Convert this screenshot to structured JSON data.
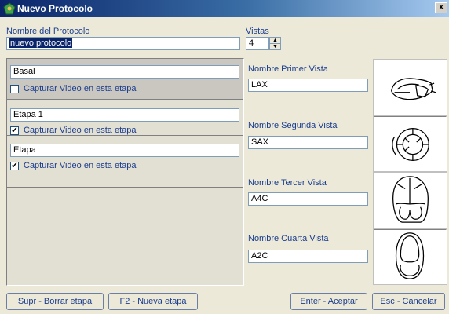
{
  "window": {
    "title": "Nuevo Protocolo",
    "close_label": "x"
  },
  "protocol": {
    "name_label": "Nombre del Protocolo",
    "name_value": "nuevo protocolo"
  },
  "views_count": {
    "label": "Vistas",
    "value": "4"
  },
  "stages": [
    {
      "name": "Basal",
      "capture_label": "Capturar Video en esta etapa",
      "checked": false
    },
    {
      "name": "Etapa 1",
      "capture_label": "Capturar Video en esta etapa",
      "checked": true
    },
    {
      "name": "Etapa",
      "capture_label": "Capturar Video en esta etapa",
      "checked": true
    }
  ],
  "views": [
    {
      "label": "Nombre Primer Vista",
      "value": "LAX",
      "icon": "lax-heart-icon"
    },
    {
      "label": "Nombre Segunda Vista",
      "value": "SAX",
      "icon": "sax-heart-icon"
    },
    {
      "label": "Nombre Tercer Vista",
      "value": "A4C",
      "icon": "a4c-heart-icon"
    },
    {
      "label": "Nombre Cuarta Vista",
      "value": "A2C",
      "icon": "a2c-heart-icon"
    }
  ],
  "buttons": {
    "delete_stage": "Supr - Borrar etapa",
    "new_stage": "F2 - Nueva etapa",
    "accept": "Enter - Aceptar",
    "cancel": "Esc - Cancelar"
  },
  "colors": {
    "titlebar": "#0a246a",
    "label_text": "#1a3d8f",
    "selection": "#0a246a"
  }
}
